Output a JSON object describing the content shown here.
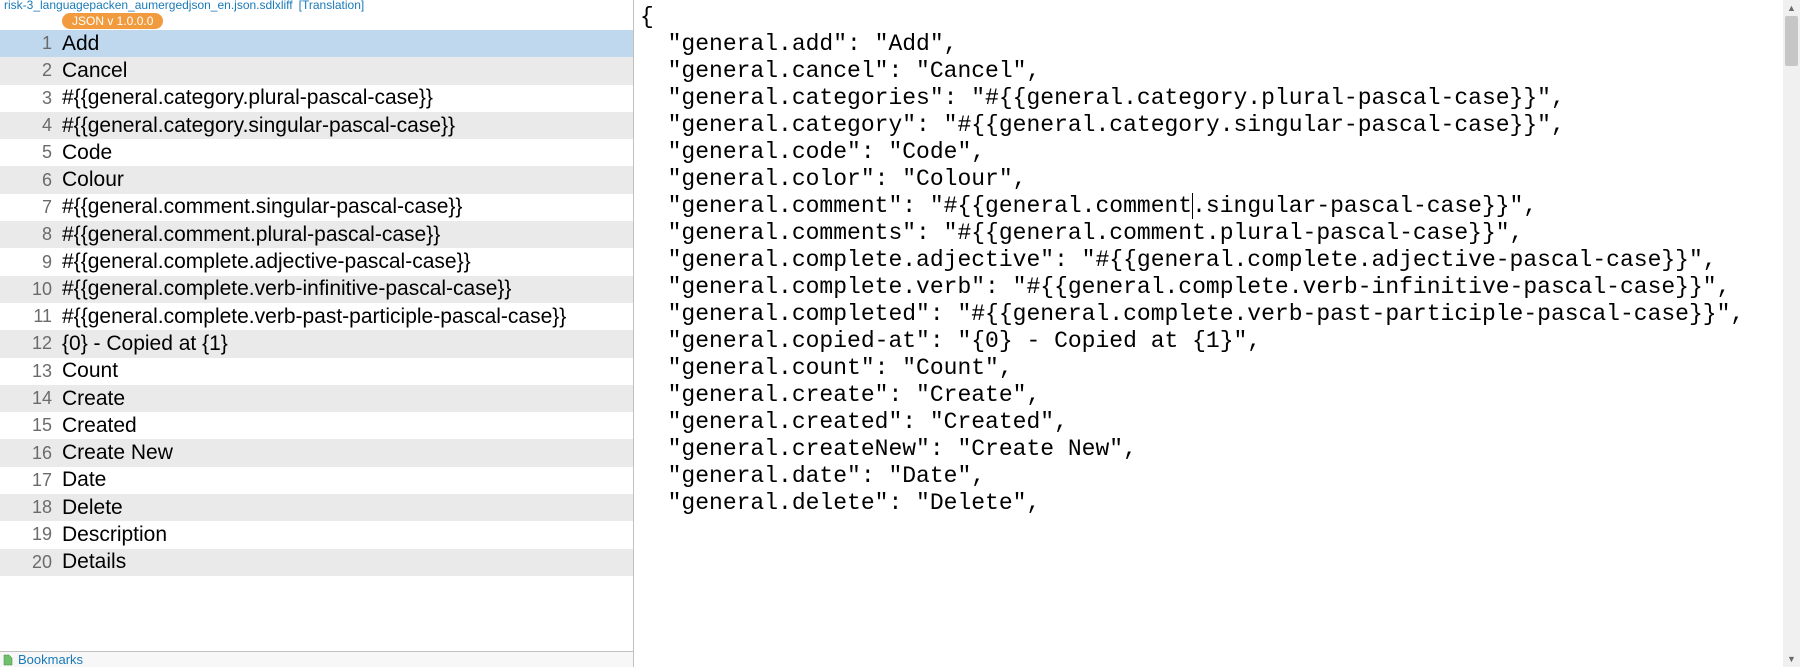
{
  "tab": {
    "filename": "risk-3_languagepacken_aumergedjson_en.json.sdlxliff",
    "state": "[Translation]"
  },
  "badge": {
    "label": "JSON v 1.0.0.0"
  },
  "rows": [
    {
      "num": 1,
      "text": "Add",
      "selected": true
    },
    {
      "num": 2,
      "text": "Cancel"
    },
    {
      "num": 3,
      "text": "#{{general.category.plural-pascal-case}}"
    },
    {
      "num": 4,
      "text": "#{{general.category.singular-pascal-case}}"
    },
    {
      "num": 5,
      "text": "Code"
    },
    {
      "num": 6,
      "text": "Colour"
    },
    {
      "num": 7,
      "text": "#{{general.comment.singular-pascal-case}}"
    },
    {
      "num": 8,
      "text": "#{{general.comment.plural-pascal-case}}"
    },
    {
      "num": 9,
      "text": "#{{general.complete.adjective-pascal-case}}"
    },
    {
      "num": 10,
      "text": "#{{general.complete.verb-infinitive-pascal-case}}"
    },
    {
      "num": 11,
      "text": "#{{general.complete.verb-past-participle-pascal-case}}"
    },
    {
      "num": 12,
      "text": "{0} - Copied at {1}"
    },
    {
      "num": 13,
      "text": "Count"
    },
    {
      "num": 14,
      "text": "Create"
    },
    {
      "num": 15,
      "text": "Created"
    },
    {
      "num": 16,
      "text": "Create New"
    },
    {
      "num": 17,
      "text": "Date"
    },
    {
      "num": 18,
      "text": "Delete"
    },
    {
      "num": 19,
      "text": "Description"
    },
    {
      "num": 20,
      "text": "Details"
    }
  ],
  "bottom": {
    "bookmarks": "Bookmarks"
  },
  "code": {
    "lines": [
      "{",
      "  \"general.add\": \"Add\",",
      "  \"general.cancel\": \"Cancel\",",
      "  \"general.categories\": \"#{{general.category.plural-pascal-case}}\",",
      "  \"general.category\": \"#{{general.category.singular-pascal-case}}\",",
      "  \"general.code\": \"Code\",",
      "  \"general.color\": \"Colour\",",
      "  \"general.comment\": \"#{{general.comment|.singular-pascal-case}}\",",
      "  \"general.comments\": \"#{{general.comment.plural-pascal-case}}\",",
      "  \"general.complete.adjective\": \"#{{general.complete.adjective-pascal-case}}\",",
      "  \"general.complete.verb\": \"#{{general.complete.verb-infinitive-pascal-case}}\",",
      "  \"general.completed\": \"#{{general.complete.verb-past-participle-pascal-case}}\",",
      "  \"general.copied-at\": \"{0} - Copied at {1}\",",
      "  \"general.count\": \"Count\",",
      "  \"general.create\": \"Create\",",
      "  \"general.created\": \"Created\",",
      "  \"general.createNew\": \"Create New\",",
      "  \"general.date\": \"Date\",",
      "  \"general.delete\": \"Delete\","
    ]
  }
}
